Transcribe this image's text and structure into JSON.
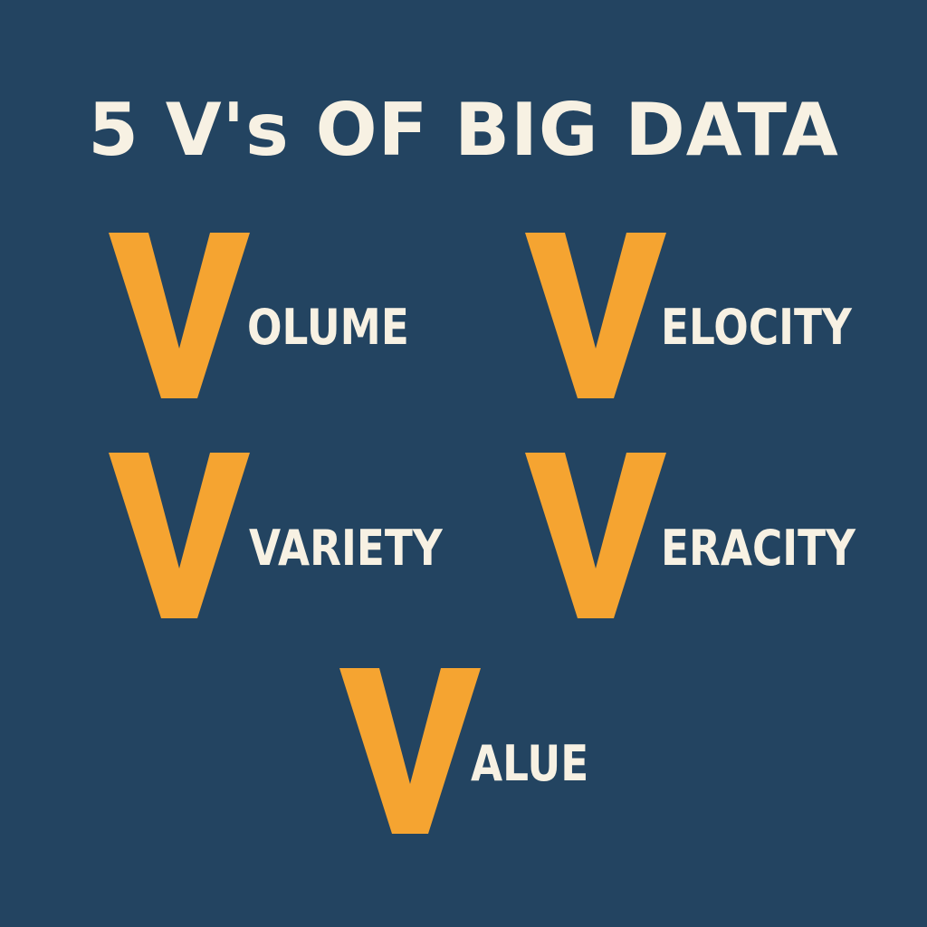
{
  "title": "5 V's OF BIG DATA",
  "accent_color": "#f5a431",
  "text_color": "#f7f1e3",
  "background_color": "#234461",
  "big_letter": "V",
  "items": [
    {
      "initial": "V",
      "rest": "OLUME",
      "word": "Volume"
    },
    {
      "initial": "V",
      "rest": "ELOCITY",
      "word": "Velocity"
    },
    {
      "initial": "V",
      "rest": "VARIETY",
      "word": "Variety"
    },
    {
      "initial": "V",
      "rest": "ERACITY",
      "word": "Veracity"
    },
    {
      "initial": "V",
      "rest": "ALUE",
      "word": "Value"
    }
  ]
}
